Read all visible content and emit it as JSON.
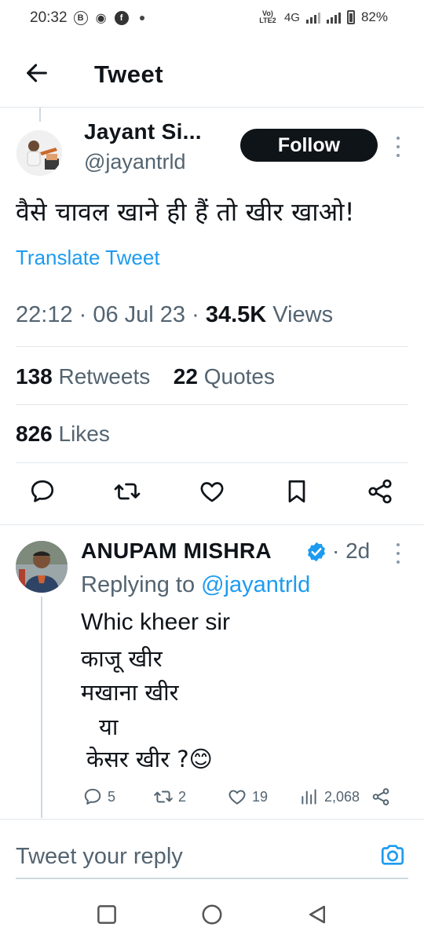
{
  "status_bar": {
    "time": "20:32",
    "icons_left": [
      "b-icon",
      "c-icon",
      "facebook-icon",
      "dot-icon"
    ],
    "volte": "Vo) LTE2",
    "network": "4G",
    "battery": "82%"
  },
  "header": {
    "title": "Tweet"
  },
  "tweet": {
    "author_name": "Jayant Si...",
    "author_handle": "@jayantrld",
    "follow_label": "Follow",
    "text": "वैसे चावल खाने ही हैं तो खीर खाओ!",
    "translate_label": "Translate Tweet",
    "time": "22:12",
    "date": "06 Jul 23",
    "views_count": "34.5K",
    "views_label": "Views",
    "retweets_count": "138",
    "retweets_label": "Retweets",
    "quotes_count": "22",
    "quotes_label": "Quotes",
    "likes_count": "826",
    "likes_label": "Likes"
  },
  "reply": {
    "author_name": "ANUPAM MISHRA",
    "time": "2d",
    "replying_prefix": "Replying to",
    "replying_handle": "@jayantrld",
    "lines": [
      "Whic kheer sir",
      "काजू खीर",
      "मखाना खीर",
      "या",
      "केसर खीर ?😊"
    ],
    "replies": "5",
    "retweets": "2",
    "likes": "19",
    "views": "2,068"
  },
  "reply_bar": {
    "placeholder": "Tweet your reply"
  },
  "colors": {
    "accent": "#1d9bf0",
    "text": "#0f1419",
    "secondary": "#536471",
    "divider": "#e1e6ea"
  }
}
